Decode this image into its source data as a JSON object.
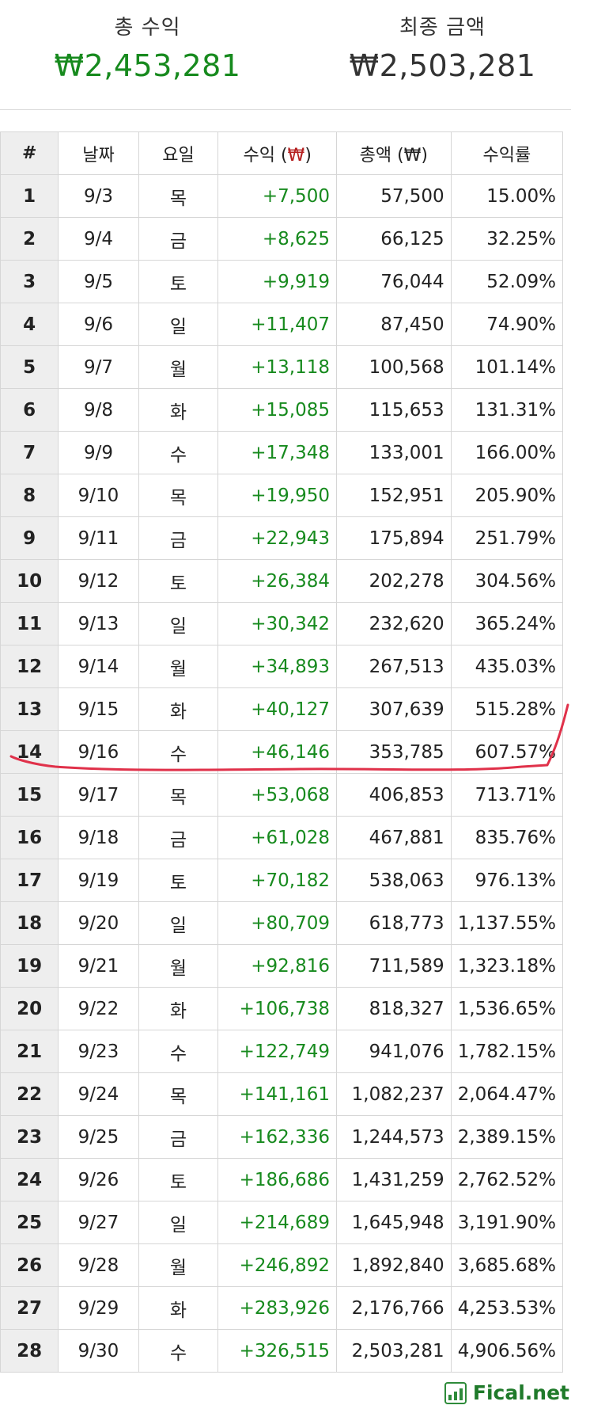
{
  "summary": {
    "profit_label": "총 수익",
    "profit_value": "₩2,453,281",
    "final_label": "최종 금액",
    "final_value": "₩2,503,281"
  },
  "table": {
    "headers": {
      "idx": "#",
      "date": "날짜",
      "dow": "요일",
      "profit_prefix": "수익 (",
      "profit_won": "₩",
      "profit_suffix": ")",
      "total": "총액 (₩)",
      "rate": "수익률"
    },
    "rows": [
      {
        "idx": "1",
        "date": "9/3",
        "dow": "목",
        "profit": "+7,500",
        "total": "57,500",
        "rate": "15.00%"
      },
      {
        "idx": "2",
        "date": "9/4",
        "dow": "금",
        "profit": "+8,625",
        "total": "66,125",
        "rate": "32.25%"
      },
      {
        "idx": "3",
        "date": "9/5",
        "dow": "토",
        "profit": "+9,919",
        "total": "76,044",
        "rate": "52.09%"
      },
      {
        "idx": "4",
        "date": "9/6",
        "dow": "일",
        "profit": "+11,407",
        "total": "87,450",
        "rate": "74.90%"
      },
      {
        "idx": "5",
        "date": "9/7",
        "dow": "월",
        "profit": "+13,118",
        "total": "100,568",
        "rate": "101.14%"
      },
      {
        "idx": "6",
        "date": "9/8",
        "dow": "화",
        "profit": "+15,085",
        "total": "115,653",
        "rate": "131.31%"
      },
      {
        "idx": "7",
        "date": "9/9",
        "dow": "수",
        "profit": "+17,348",
        "total": "133,001",
        "rate": "166.00%"
      },
      {
        "idx": "8",
        "date": "9/10",
        "dow": "목",
        "profit": "+19,950",
        "total": "152,951",
        "rate": "205.90%"
      },
      {
        "idx": "9",
        "date": "9/11",
        "dow": "금",
        "profit": "+22,943",
        "total": "175,894",
        "rate": "251.79%"
      },
      {
        "idx": "10",
        "date": "9/12",
        "dow": "토",
        "profit": "+26,384",
        "total": "202,278",
        "rate": "304.56%"
      },
      {
        "idx": "11",
        "date": "9/13",
        "dow": "일",
        "profit": "+30,342",
        "total": "232,620",
        "rate": "365.24%"
      },
      {
        "idx": "12",
        "date": "9/14",
        "dow": "월",
        "profit": "+34,893",
        "total": "267,513",
        "rate": "435.03%"
      },
      {
        "idx": "13",
        "date": "9/15",
        "dow": "화",
        "profit": "+40,127",
        "total": "307,639",
        "rate": "515.28%"
      },
      {
        "idx": "14",
        "date": "9/16",
        "dow": "수",
        "profit": "+46,146",
        "total": "353,785",
        "rate": "607.57%"
      },
      {
        "idx": "15",
        "date": "9/17",
        "dow": "목",
        "profit": "+53,068",
        "total": "406,853",
        "rate": "713.71%"
      },
      {
        "idx": "16",
        "date": "9/18",
        "dow": "금",
        "profit": "+61,028",
        "total": "467,881",
        "rate": "835.76%"
      },
      {
        "idx": "17",
        "date": "9/19",
        "dow": "토",
        "profit": "+70,182",
        "total": "538,063",
        "rate": "976.13%"
      },
      {
        "idx": "18",
        "date": "9/20",
        "dow": "일",
        "profit": "+80,709",
        "total": "618,773",
        "rate": "1,137.55%"
      },
      {
        "idx": "19",
        "date": "9/21",
        "dow": "월",
        "profit": "+92,816",
        "total": "711,589",
        "rate": "1,323.18%"
      },
      {
        "idx": "20",
        "date": "9/22",
        "dow": "화",
        "profit": "+106,738",
        "total": "818,327",
        "rate": "1,536.65%"
      },
      {
        "idx": "21",
        "date": "9/23",
        "dow": "수",
        "profit": "+122,749",
        "total": "941,076",
        "rate": "1,782.15%"
      },
      {
        "idx": "22",
        "date": "9/24",
        "dow": "목",
        "profit": "+141,161",
        "total": "1,082,237",
        "rate": "2,064.47%"
      },
      {
        "idx": "23",
        "date": "9/25",
        "dow": "금",
        "profit": "+162,336",
        "total": "1,244,573",
        "rate": "2,389.15%"
      },
      {
        "idx": "24",
        "date": "9/26",
        "dow": "토",
        "profit": "+186,686",
        "total": "1,431,259",
        "rate": "2,762.52%"
      },
      {
        "idx": "25",
        "date": "9/27",
        "dow": "일",
        "profit": "+214,689",
        "total": "1,645,948",
        "rate": "3,191.90%"
      },
      {
        "idx": "26",
        "date": "9/28",
        "dow": "월",
        "profit": "+246,892",
        "total": "1,892,840",
        "rate": "3,685.68%"
      },
      {
        "idx": "27",
        "date": "9/29",
        "dow": "화",
        "profit": "+283,926",
        "total": "2,176,766",
        "rate": "4,253.53%"
      },
      {
        "idx": "28",
        "date": "9/30",
        "dow": "수",
        "profit": "+326,515",
        "total": "2,503,281",
        "rate": "4,906.56%"
      }
    ]
  },
  "brand": {
    "name": "Fical.net",
    "icon": "bar-chart-logo-icon"
  },
  "colors": {
    "profit_green": "#178a1e",
    "annotation_red": "#e0314a"
  }
}
